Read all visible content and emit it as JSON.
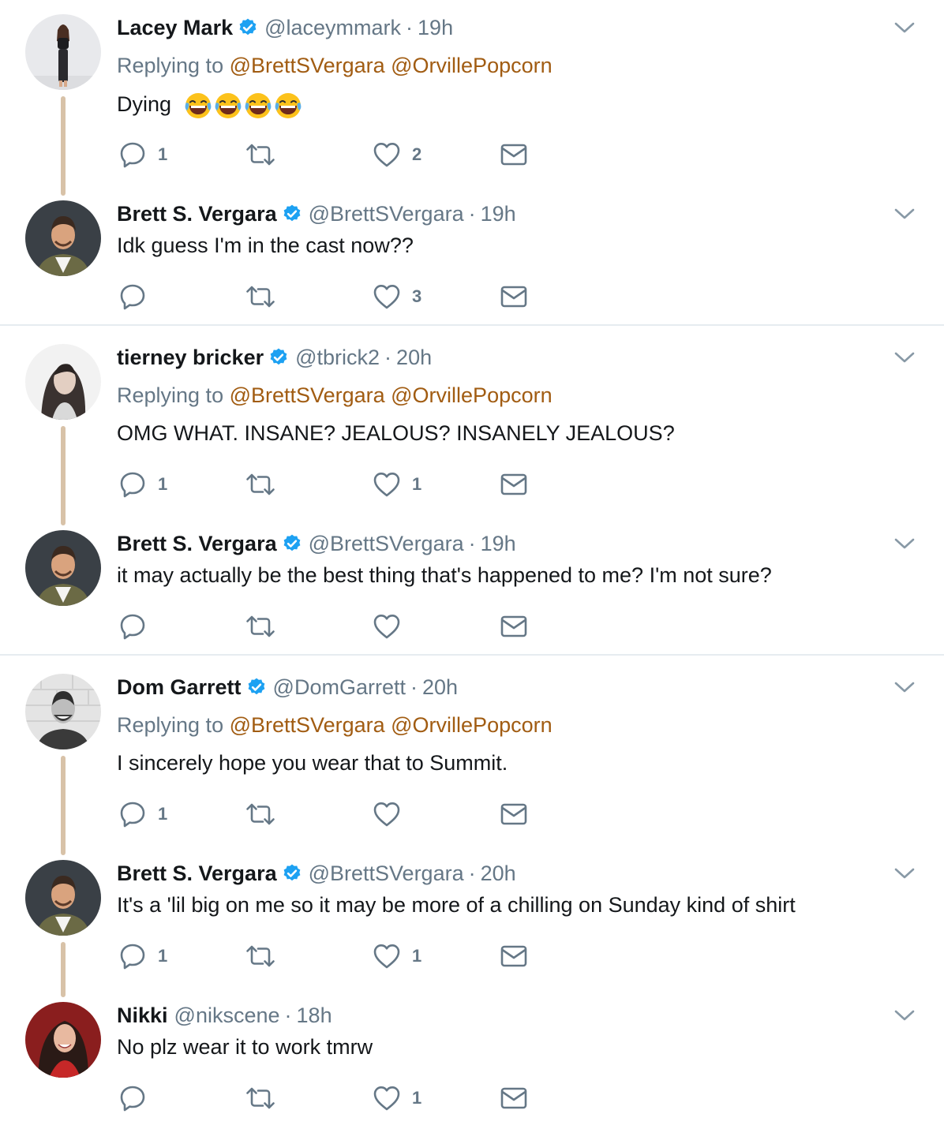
{
  "colors": {
    "mention": "#a15c12",
    "muted": "#657786",
    "verified": "#1da1f2",
    "thread_line": "#d8c2a8"
  },
  "tweets": [
    {
      "name": "Lacey Mark",
      "verified": true,
      "handle": "@laceymmark",
      "time": "19h",
      "replying_label": "Replying to",
      "mention1": "@BrettSVergara",
      "mention2": "@OrvillePopcorn",
      "text": "Dying",
      "emoji": "face-with-tears-of-joy x4",
      "reply_count": "1",
      "like_count": "2"
    },
    {
      "name": "Brett S. Vergara",
      "verified": true,
      "handle": "@BrettSVergara",
      "time": "19h",
      "text": "Idk guess I'm in the cast now??",
      "reply_count": "",
      "like_count": "3"
    },
    {
      "name": "tierney bricker",
      "verified": true,
      "handle": "@tbrick2",
      "time": "20h",
      "replying_label": "Replying to",
      "mention1": "@BrettSVergara",
      "mention2": "@OrvillePopcorn",
      "text": "OMG WHAT. INSANE? JEALOUS? INSANELY JEALOUS?",
      "reply_count": "1",
      "like_count": "1"
    },
    {
      "name": "Brett S. Vergara",
      "verified": true,
      "handle": "@BrettSVergara",
      "time": "19h",
      "text": "it may actually be the best thing that's happened to me? I'm not sure?",
      "reply_count": "",
      "like_count": ""
    },
    {
      "name": "Dom Garrett",
      "verified": true,
      "handle": "@DomGarrett",
      "time": "20h",
      "replying_label": "Replying to",
      "mention1": "@BrettSVergara",
      "mention2": "@OrvillePopcorn",
      "text": "I sincerely hope you wear that to Summit.",
      "reply_count": "1",
      "like_count": ""
    },
    {
      "name": "Brett S. Vergara",
      "verified": true,
      "handle": "@BrettSVergara",
      "time": "20h",
      "text": "It's a 'lil big on me so it may be more of a chilling on Sunday kind of shirt",
      "reply_count": "1",
      "like_count": "1"
    },
    {
      "name": "Nikki",
      "verified": false,
      "handle": "@nikscene",
      "time": "18h",
      "text": "No plz wear it to work tmrw",
      "reply_count": "",
      "like_count": "1"
    }
  ]
}
